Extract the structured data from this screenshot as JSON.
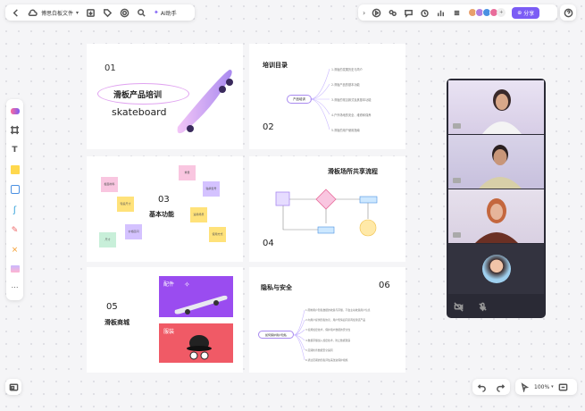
{
  "toolbar": {
    "file_name": "博思白板文件",
    "ai_label": "AI助手",
    "share_label": "分享",
    "avatar_more": "+"
  },
  "avatars": [
    "#e8a06c",
    "#b07de0",
    "#4a90e2",
    "#e86c9a"
  ],
  "cards": {
    "c1": {
      "num": "01",
      "title": "滑板产品培训",
      "subtitle": "skateboard"
    },
    "c2": {
      "title": "培训目录",
      "num": "02",
      "center": "产品培训",
      "items": [
        "1.滑板的发展历史与简介",
        "2.滑板产品的基本功能",
        "3.滑板的常见款式及其基本功能",
        "4.户外场地的安全、维修和保养",
        "5.滑板的用户使用指南"
      ]
    },
    "c3": {
      "num": "03",
      "title": "基本功能",
      "notes": [
        "板面材料",
        "轮毂尺寸",
        "重量",
        "轴承型号",
        "适用场景",
        "价格区间",
        "尺寸",
        "使用方式"
      ]
    },
    "c4": {
      "title": "滑板场所共享流程",
      "num": "04"
    },
    "c5": {
      "num": "05",
      "title": "滑板商城",
      "tag1": "配件",
      "tag2": "服装"
    },
    "c6": {
      "title": "隐私与安全",
      "num": "06",
      "center": "如何保护用户隐私",
      "items": [
        "1.限制用户隐私数据的收集与存储，不会主动收集用户信息",
        "2.向用户提供隐私协议，用户知情后同意再使用该产品",
        "3.使用加密技术，保护用户数据的安全性",
        "4.数据存储加入加密技术，防止数据泄露",
        "5.定期检查数据安全漏洞",
        "6.通过定期的隐私评估来改进保护措施"
      ]
    }
  },
  "zoom": "100%"
}
